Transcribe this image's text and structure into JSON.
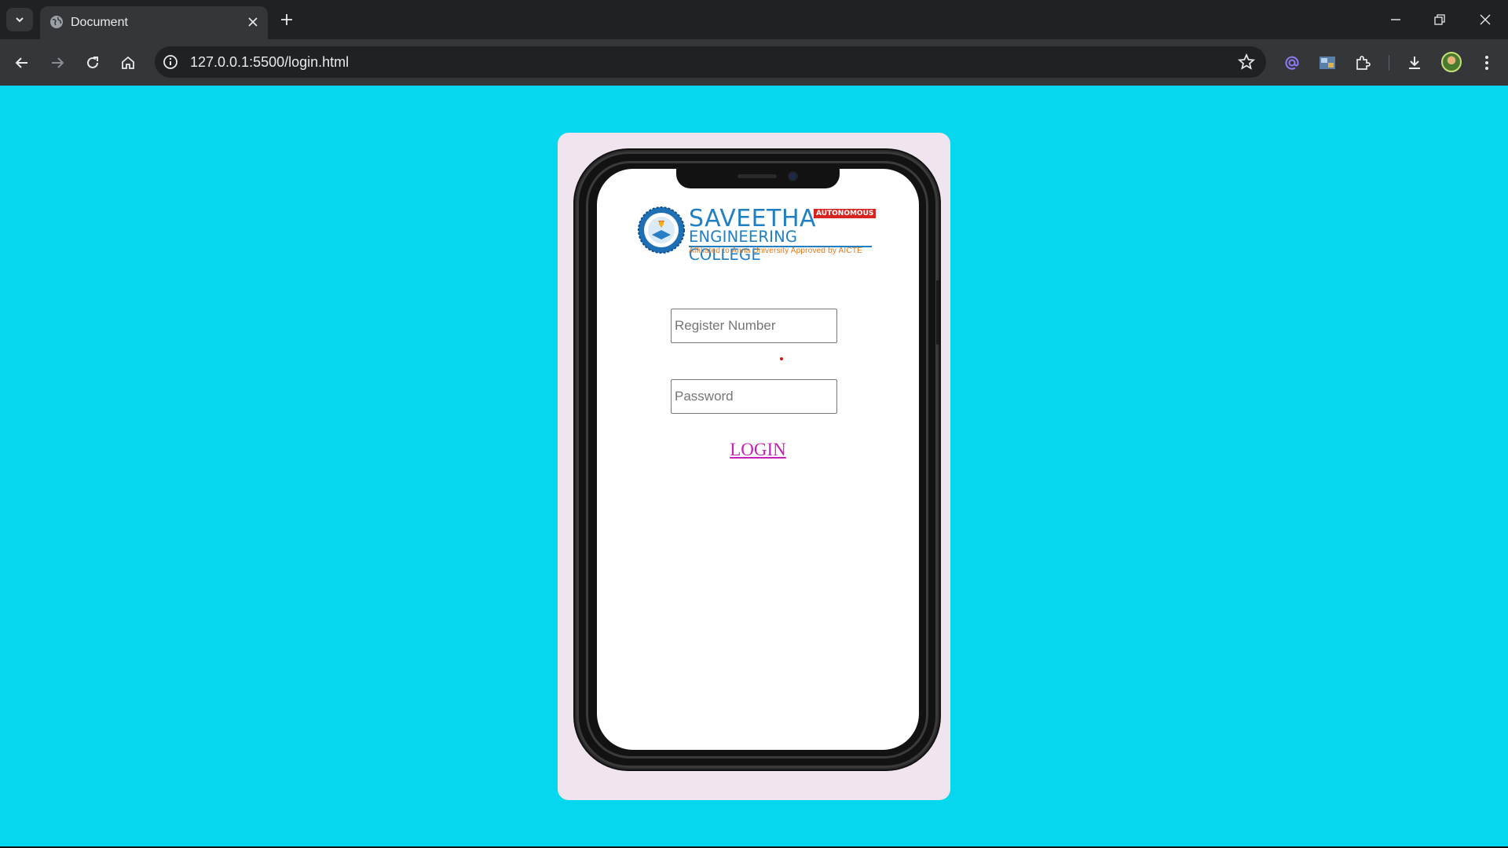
{
  "browser": {
    "tab_title": "Document",
    "url": "127.0.0.1:5500/login.html"
  },
  "page": {
    "background_color": "#06d6ee",
    "card_color": "#f0e4ef",
    "logo": {
      "name": "SAVEETHA",
      "badge": "AUTONOMOUS",
      "subtitle": "ENGINEERING COLLEGE",
      "affiliation": "Affiliated to Anna University  Approved by AICTE"
    },
    "form": {
      "register_placeholder": "Register Number",
      "password_placeholder": "Password",
      "login_label": "LOGIN"
    }
  },
  "colors": {
    "logo_blue": "#1f7fc2",
    "logo_orange": "#e4761d",
    "badge_red": "#d8231f",
    "link_magenta": "#c620b8"
  }
}
